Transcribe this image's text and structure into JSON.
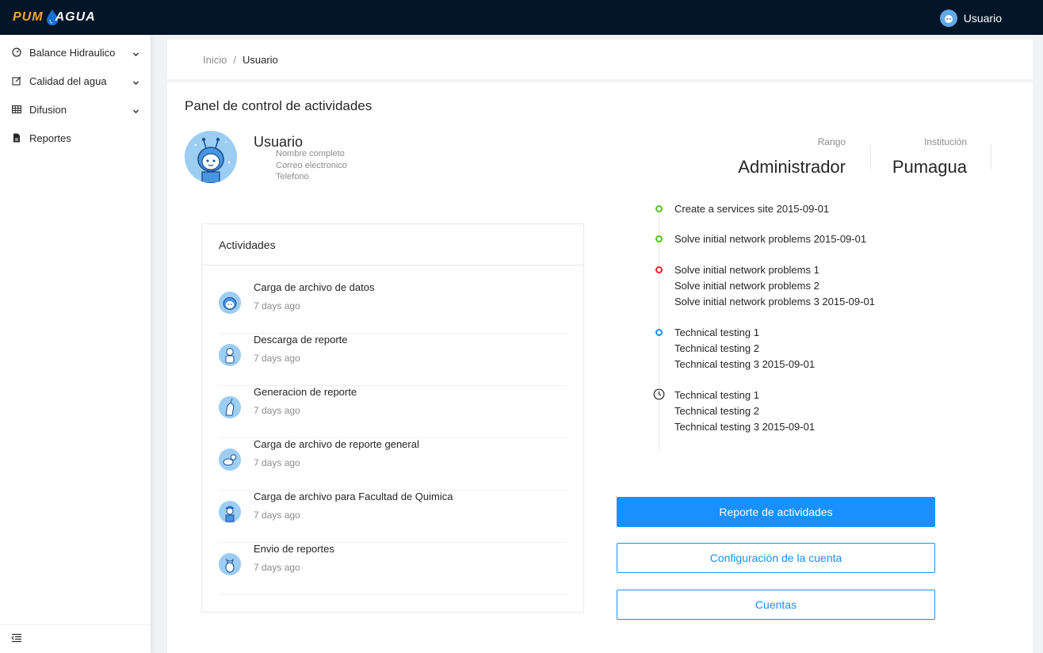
{
  "header": {
    "logo_part1": "PUM",
    "logo_part2": "AGUA",
    "user_label": "Usuario"
  },
  "sidebar": {
    "items": [
      {
        "label": "Balance Hidraulico",
        "icon": "dashboard-icon",
        "has_submenu": true
      },
      {
        "label": "Calidad del agua",
        "icon": "edit-icon",
        "has_submenu": true
      },
      {
        "label": "Difusion",
        "icon": "table-icon",
        "has_submenu": true
      },
      {
        "label": "Reportes",
        "icon": "file-icon",
        "has_submenu": false
      }
    ],
    "collapse_icon": "menu-fold-icon"
  },
  "breadcrumb": {
    "home": "Inicio",
    "separator": "/",
    "current": "Usuario"
  },
  "page": {
    "title": "Panel de control de actividades"
  },
  "profile": {
    "name": "Usuario",
    "full_name_label": "Nombre completo",
    "email_label": "Correo electronico",
    "phone_label": "Telefono"
  },
  "stats": {
    "rank_label": "Rango",
    "rank_value": "Administrador",
    "institution_label": "Institución",
    "institution_value": "Pumagua"
  },
  "activities": {
    "title": "Actividades",
    "items": [
      {
        "title": "Carga de archivo de datos",
        "time": "7 days ago"
      },
      {
        "title": "Descarga de reporte",
        "time": "7 days ago"
      },
      {
        "title": "Generacion de reporte",
        "time": "7 days ago"
      },
      {
        "title": "Carga de archivo de reporte general",
        "time": "7 days ago"
      },
      {
        "title": "Carga de archivo para Facultad  de Quimica",
        "time": "7 days ago"
      },
      {
        "title": "Envio de reportes",
        "time": "7 days ago"
      }
    ]
  },
  "timeline": {
    "items": [
      {
        "color": "#52c41a",
        "lines": [
          "Create a services site 2015-09-01"
        ]
      },
      {
        "color": "#52c41a",
        "lines": [
          "Solve initial network problems 2015-09-01"
        ]
      },
      {
        "color": "#f5222d",
        "lines": [
          "Solve initial network problems 1",
          "Solve initial network problems 2",
          "Solve initial network problems 3 2015-09-01"
        ]
      },
      {
        "color": "#1890ff",
        "lines": [
          "Technical testing 1",
          "Technical testing 2",
          "Technical testing 3 2015-09-01"
        ]
      },
      {
        "color": "clock",
        "lines": [
          "Technical testing 1",
          "Technical testing 2",
          "Technical testing 3 2015-09-01"
        ]
      }
    ]
  },
  "buttons": {
    "activity_report": "Reporte de actividades",
    "account_settings": "Configuración de la cuenta",
    "accounts": "Cuentas"
  },
  "colors": {
    "header_bg": "#021529",
    "accent": "#1890ff",
    "logo_orange": "#f0a431"
  }
}
